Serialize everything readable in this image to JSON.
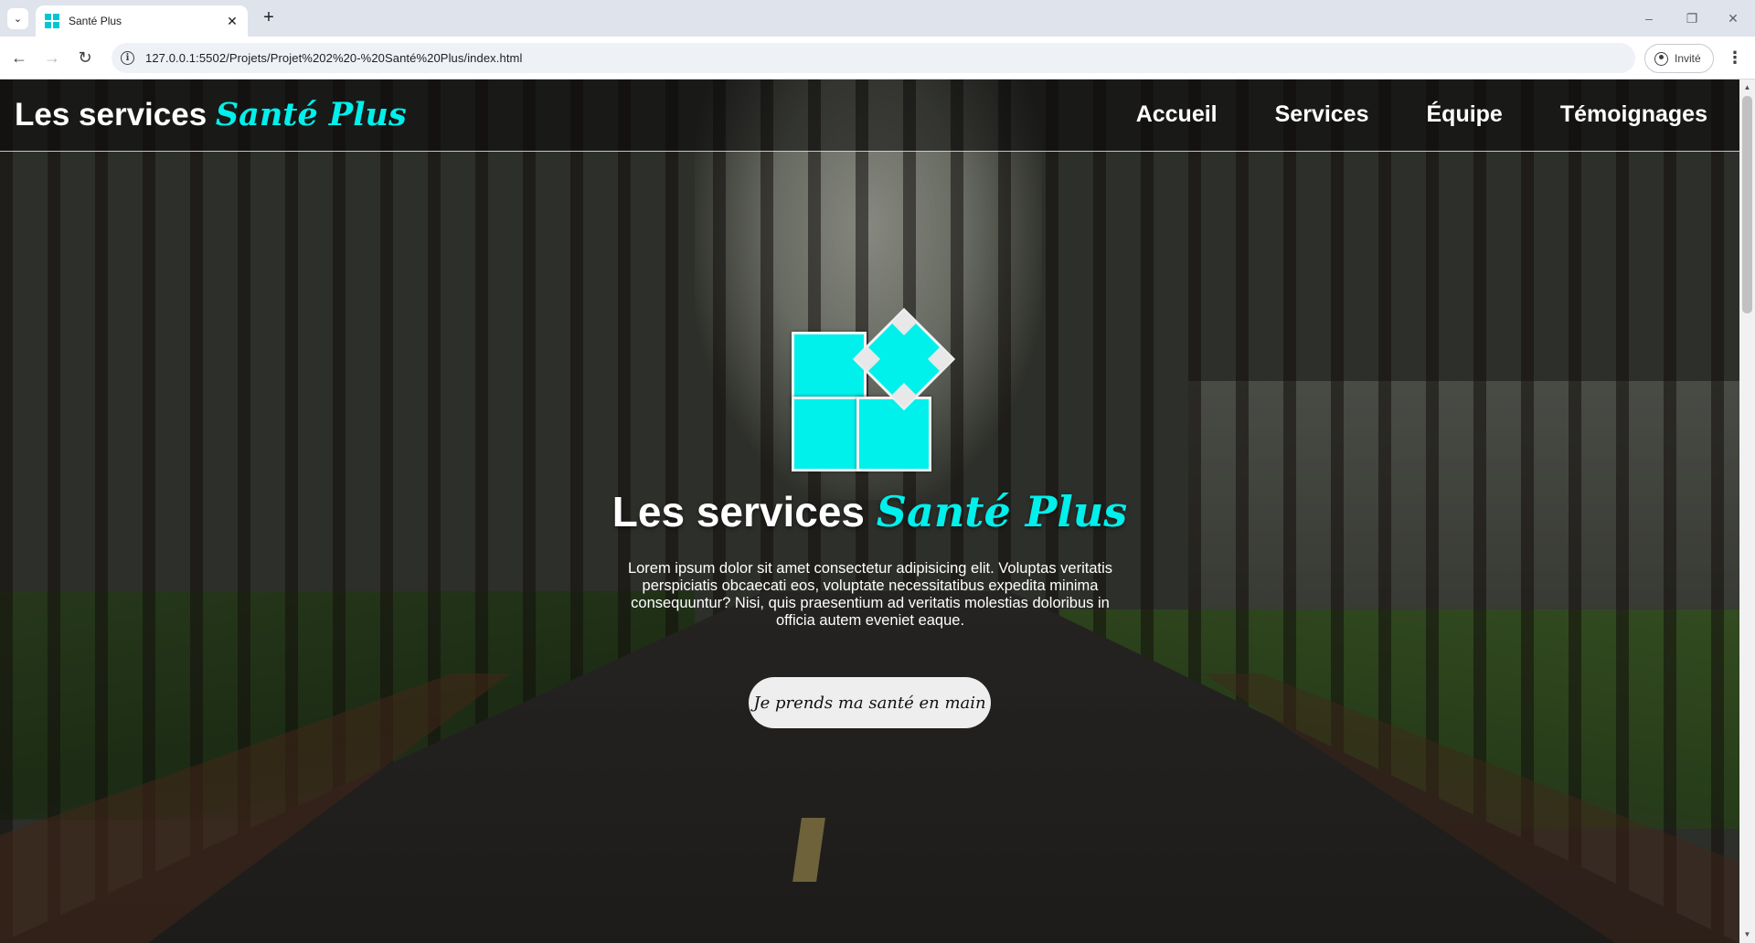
{
  "browser": {
    "tab_title": "Santé Plus",
    "url": "127.0.0.1:5502/Projets/Projet%202%20-%20Santé%20Plus/index.html",
    "profile_label": "Invité"
  },
  "header": {
    "brand_main": "Les services ",
    "brand_accent": "Santé Plus",
    "nav": [
      "Accueil",
      "Services",
      "Équipe",
      "Témoignages"
    ]
  },
  "hero": {
    "title_main": "Les services ",
    "title_accent": "Santé Plus",
    "text": "Lorem ipsum dolor sit amet consectetur adipisicing elit. Voluptas veritatis perspiciatis obcaecati eos, voluptate necessitatibus expedita minima consequuntur? Nisi, quis praesentium ad veritatis molestias doloribus in officia autem eveniet eaque.",
    "cta_label": "Je prends ma santé en main"
  },
  "colors": {
    "accent": "#00f0ec",
    "header_bg": "#0a0a0a",
    "button_bg": "#eeeeee",
    "tab_strip": "#dfe3eb"
  },
  "icons": {
    "favicon": "grid-logo-icon",
    "logo": "health-plus-logo-icon"
  }
}
